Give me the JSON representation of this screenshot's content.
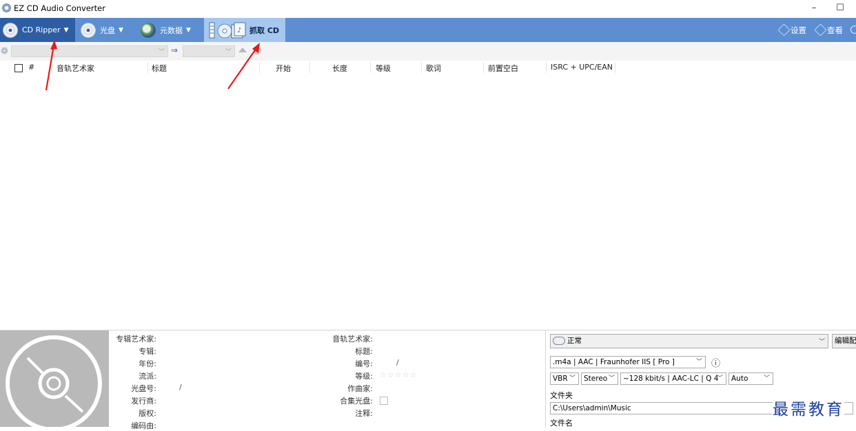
{
  "window": {
    "title": "EZ CD Audio Converter",
    "minimize": "–",
    "maximize": "☐"
  },
  "ribbon": {
    "tabs": [
      {
        "label": "CD Ripper",
        "dropdown": "▼"
      },
      {
        "label": "光盘",
        "dropdown": "▼"
      },
      {
        "label": "元数据",
        "dropdown": "▼"
      },
      {
        "label": "抓取 CD"
      }
    ],
    "settings_label": "设置",
    "view_label": "查看"
  },
  "toolbar": {
    "arrow": "⇒"
  },
  "columns": [
    "#",
    "音轨艺术家",
    "标题",
    "开始",
    "长度",
    "等级",
    "歌词",
    "前置空白",
    "ISRC + UPC/EAN"
  ],
  "album_fields": [
    {
      "label": "专辑艺术家:",
      "value": ""
    },
    {
      "label": "专辑:",
      "value": ""
    },
    {
      "label": "年份:",
      "value": ""
    },
    {
      "label": "流派:",
      "value": ""
    },
    {
      "label": "光盘号:",
      "value": "/"
    },
    {
      "label": "发行商:",
      "value": ""
    },
    {
      "label": "版权:",
      "value": ""
    },
    {
      "label": "编码由:",
      "value": ""
    }
  ],
  "track_fields": [
    {
      "label": "音轨艺术家:",
      "value": ""
    },
    {
      "label": "标题:",
      "value": ""
    },
    {
      "label": "编号:",
      "value": "/"
    },
    {
      "label": "等级:",
      "value": "☆☆☆☆☆"
    },
    {
      "label": "作曲家:",
      "value": ""
    },
    {
      "label": "合集光盘:",
      "value": ""
    },
    {
      "label": "注释:",
      "value": ""
    }
  ],
  "output": {
    "profile": "正常",
    "edit_button": "编辑配",
    "format": ".m4a  |  AAC  |  Fraunhofer IIS [ Pro ]",
    "info_icon": "ⓘ",
    "mode": "VBR",
    "channels": "Stereo",
    "bitrate": "~128 kbit/s | AAC-LC | Q 4",
    "auto": "Auto",
    "folder_label": "文件夹",
    "folder_path": "C:\\Users\\admin\\Music",
    "filename_label": "文件名"
  },
  "watermark": "最需教育",
  "colors": {
    "ribbon": "#5c8ed1",
    "ribbon_active": "#2d5ea5",
    "ribbon_selected": "#a6c7ef",
    "annotation_arrow": "#e8191a"
  }
}
